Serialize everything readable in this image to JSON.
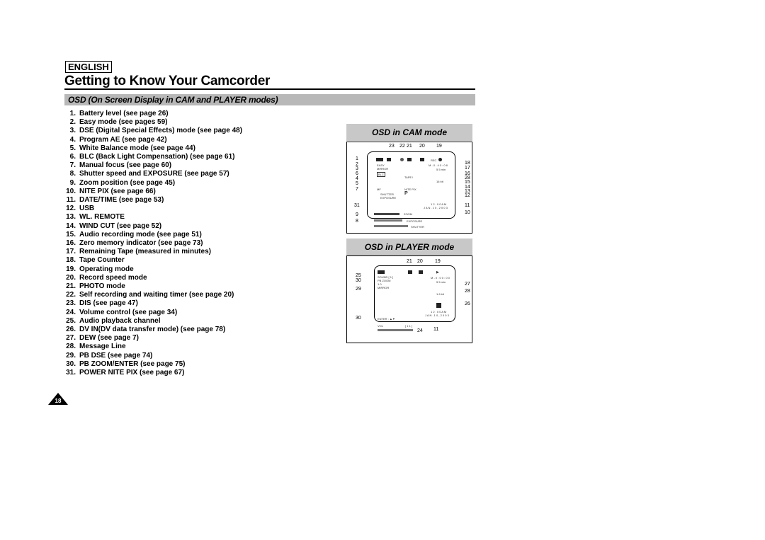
{
  "header": {
    "language": "ENGLISH",
    "title": "Getting to Know Your Camcorder",
    "section": "OSD (On Screen Display in CAM and PLAYER modes)"
  },
  "items": [
    {
      "n": "1.",
      "text": "Battery level (see page 26)"
    },
    {
      "n": "2.",
      "text": "Easy mode (see pages 59)"
    },
    {
      "n": "3.",
      "text": "DSE (Digital Special Effects) mode (see page 48)"
    },
    {
      "n": "4.",
      "text": "Program AE (see page 42)"
    },
    {
      "n": "5.",
      "text": "White Balance mode (see page 44)"
    },
    {
      "n": "6.",
      "text": "BLC (Back Light Compensation) (see page 61)"
    },
    {
      "n": "7.",
      "text": "Manual focus (see page 60)"
    },
    {
      "n": "8.",
      "text": "Shutter speed and EXPOSURE (see page 57)"
    },
    {
      "n": "9.",
      "text": "Zoom position (see page 45)"
    },
    {
      "n": "10.",
      "text": "NITE PIX (see page 66)"
    },
    {
      "n": "11.",
      "text": "DATE/TIME (see page 53)"
    },
    {
      "n": "12.",
      "text": "USB"
    },
    {
      "n": "13.",
      "text": "WL. REMOTE"
    },
    {
      "n": "14.",
      "text": "WIND CUT (see page 52)"
    },
    {
      "n": "15.",
      "text": "Audio recording mode (see page 51)"
    },
    {
      "n": "16.",
      "text": "Zero memory indicator (see page 73)"
    },
    {
      "n": "17.",
      "text": "Remaining Tape (measured in minutes)"
    },
    {
      "n": "18.",
      "text": "Tape Counter"
    },
    {
      "n": "19.",
      "text": "Operating mode"
    },
    {
      "n": "20.",
      "text": "Record speed mode"
    },
    {
      "n": "21.",
      "text": "PHOTO mode"
    },
    {
      "n": "22.",
      "text": "Self recording and waiting timer (see page 20)"
    },
    {
      "n": "23.",
      "text": "DIS (see page 47)"
    },
    {
      "n": "24.",
      "text": "Volume control (see page 34)"
    },
    {
      "n": "25.",
      "text": "Audio playback channel"
    },
    {
      "n": "26.",
      "text": "DV IN(DV data transfer mode) (see page 78)"
    },
    {
      "n": "27.",
      "text": "DEW (see page 7)"
    },
    {
      "n": "28.",
      "text": "Message Line"
    },
    {
      "n": "29.",
      "text": "PB DSE (see page 74)"
    },
    {
      "n": "30.",
      "text": "PB ZOOM/ENTER (see page 75)"
    },
    {
      "n": "31.",
      "text": "POWER NITE PIX (see page 67)"
    }
  ],
  "page_number": "18",
  "cam": {
    "heading": "OSD in CAM mode",
    "top_nums": [
      "23",
      "22",
      "21",
      "20",
      "19"
    ],
    "left_nums": [
      "1",
      "2",
      "3",
      "6",
      "4",
      "5",
      "7",
      "31",
      "9",
      "8"
    ],
    "right_nums": [
      "18",
      "17",
      "16",
      "28",
      "15",
      "14",
      "13",
      "12",
      "11",
      "10"
    ],
    "labels": {
      "rec": "REC",
      "easy": "EASY",
      "mirror": "MIRROR",
      "blc": "BLC",
      "mf": "MF",
      "shutter": "SHUTTER",
      "exposure": "EXPOSURE",
      "nite_pix": "NITE PIX",
      "p": "P",
      "counter": "M - 0 : 4 0 : 0 8",
      "remaining": "5 5 min",
      "tape": "TAPE !",
      "audio": "16 bit",
      "time": "1 2 : 0 0 A M",
      "date": "J A N . 1 0 , 2 0 0 3",
      "zoom": "ZOOM",
      "exposure_bar": "EXPOSURE",
      "shutter_bar": "SHUTTER"
    }
  },
  "player": {
    "heading": "OSD in PLAYER mode",
    "top_nums": [
      "21",
      "20",
      "19"
    ],
    "left_nums": [
      "25",
      "30",
      "29",
      "30"
    ],
    "right_nums": [
      "27",
      "28",
      "26",
      "24",
      "11"
    ],
    "labels": {
      "sound": "SOUND [ 1 ]",
      "pbzoom": "PB ZOOM",
      "zoomval": "1.0",
      "mirror": "MIRROR",
      "counter": "M - 0 : 0 0 : 0 0",
      "remaining": "5 5 min",
      "audio": "1 6 bit",
      "time": "1 2 : 0 0 A M",
      "date": "J A N . 1 0 , 2 0 0 3",
      "enter": "ENTER : ▲▼",
      "vol": "VOL",
      "vol_val": "[ 1 1 ]"
    }
  }
}
